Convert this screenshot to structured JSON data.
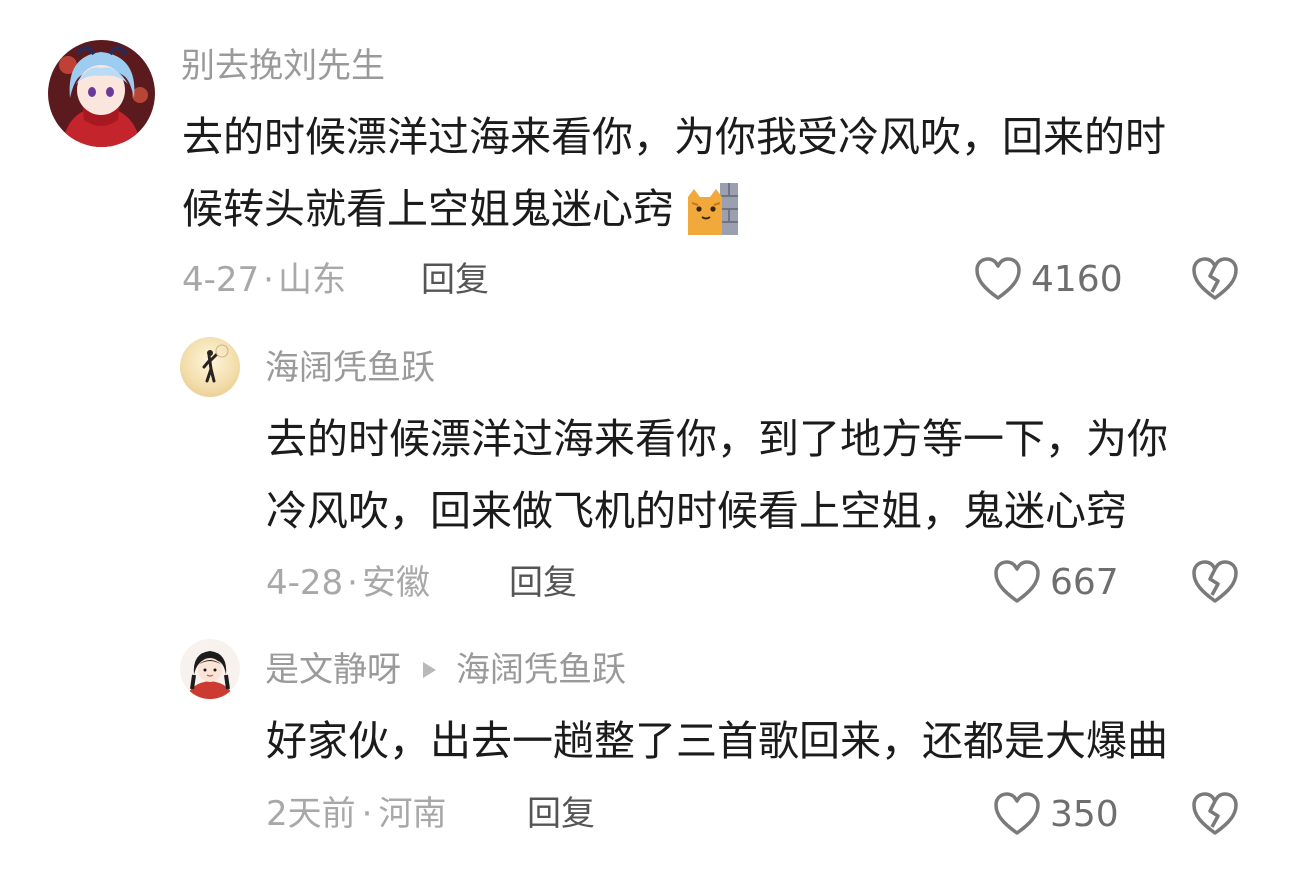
{
  "comments": [
    {
      "username": "别去挽刘先生",
      "lines": [
        "去的时候漂洋过海来看你，为你我受冷风吹，回来的时",
        "候转头就看上空姐鬼迷心窍"
      ],
      "emoji": "cat-wall-emoji",
      "date": "4-27",
      "dot": "·",
      "location": "山东",
      "reply_label": "回复",
      "likes": "4160"
    },
    {
      "username": "海阔凭鱼跃",
      "lines": [
        "去的时候漂洋过海来看你，到了地方等一下，为你",
        "冷风吹，回来做飞机的时候看上空姐，鬼迷心窍"
      ],
      "date": "4-28",
      "dot": "·",
      "location": "安徽",
      "reply_label": "回复",
      "likes": "667"
    },
    {
      "username": "是文静呀",
      "reply_to": "海阔凭鱼跃",
      "lines": [
        "好家伙，出去一趟整了三首歌回来，还都是大爆曲"
      ],
      "date": "2天前",
      "dot": "·",
      "location": "河南",
      "reply_label": "回复",
      "likes": "350"
    }
  ],
  "icons": {
    "like": "heart-outline-icon",
    "dislike": "broken-heart-icon",
    "reply_arrow": "triangle-right-icon"
  },
  "colors": {
    "text": "#1b1b1b",
    "username": "#9a9a9a",
    "meta": "#a8a8a8",
    "icon": "#7a7a7a"
  }
}
